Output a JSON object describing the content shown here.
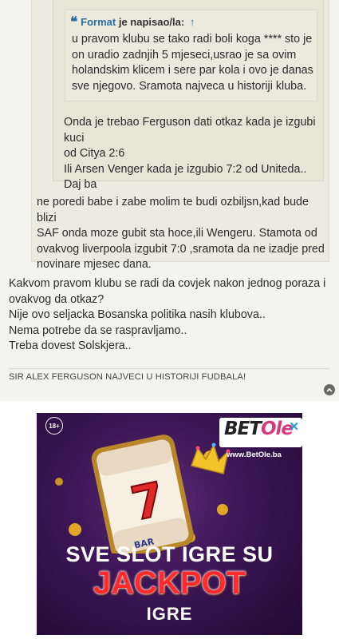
{
  "quote": {
    "author": "Format",
    "wrote_label": "je napisao/la:",
    "jump_arrow": "↑",
    "nested_quote_lines": [
      "u pravom klubu se tako radi boli koga **** sto je",
      "on uradio zadnjih 5 mjeseci,usrao je sa ovim",
      "holandskim klicem i sere par kola i ovo je danas",
      "sve njegovo. Sramota najveca u historiji kluba."
    ],
    "middle_quote_lines": [
      "Onda je trebao Ferguson dati otkaz kada je izgubi kuci",
      "od Citya 2:6",
      "Ili Arsen Venger kada je izgubio 7:2 od Uniteda..",
      "Daj ba"
    ],
    "outer_quote_lines": [
      "ne poredi babe i zabe molim te budi ozbiljsn,kad bude blizi",
      "SAF onda moze gubit sta hoce,ili Wengeru. Stamota od",
      "ovakvog liverpoola izgubit 7:0 ,sramota da ne izadje pred",
      "novinare mjesec dana."
    ]
  },
  "post": {
    "body_lines": [
      "Kakvom pravom klubu se radi da covjek nakon jednog poraza i",
      "ovakvog da otkaz?",
      "Nije ovo seljacka Bosanska politika nasih klubova..",
      "Nema potrebe da se raspravljamo..",
      "Treba dovest Solskjera.."
    ],
    "signature": "SIR ALEX FERGUSON NAJVECI U HISTORIJI FUDBALA!"
  },
  "icons": {
    "quote": "quote-icon",
    "back_to_top": "chevron-up-circle-icon",
    "ad_close": "close-icon"
  },
  "ad": {
    "age_badge": "18+",
    "brand_part1": "BET",
    "brand_part2": "Ole",
    "close_glyph": "✕",
    "url": "www.BetOle.ba",
    "slot_symbols": [
      "7",
      "BAR"
    ],
    "headline_1": "SVE SLOT IGRE SU",
    "headline_2": "JACKPOT",
    "headline_3": "IGRE"
  },
  "colors": {
    "link": "#2b6ca3",
    "page_bg": "#f4f4ef",
    "quote_bg": "#ecebdf",
    "ad_bg": "#3b1554",
    "ad_red": "#ff2a2a"
  }
}
